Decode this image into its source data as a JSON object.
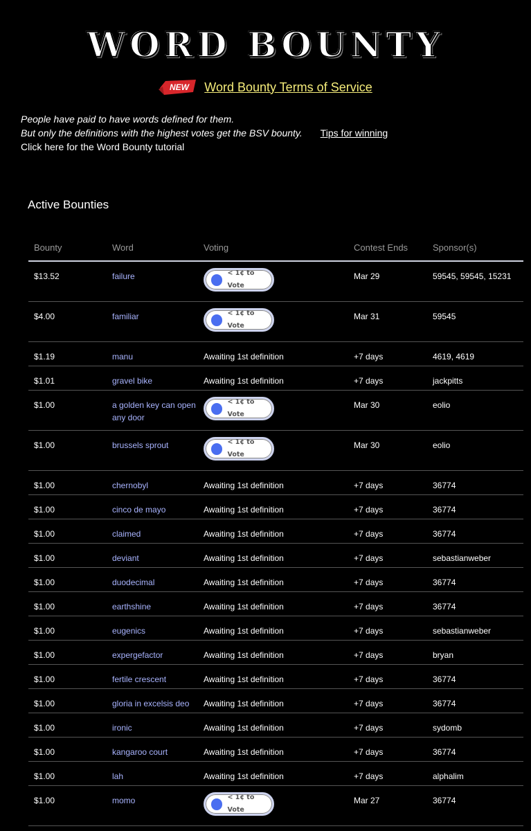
{
  "header": {
    "logo_text": "WORD BOUNTY",
    "new_badge": "NEW",
    "tos_link": "Word Bounty Terms of Service"
  },
  "intro": {
    "line1": "People have paid to have words defined for them.",
    "line2": "But only the definitions with the highest votes get the BSV bounty.",
    "tips_link": "Tips for winning",
    "tutorial_link": "Click here for the Word Bounty tutorial"
  },
  "section_title": "Active Bounties",
  "table": {
    "columns": [
      "Bounty",
      "Word",
      "Voting",
      "Contest Ends",
      "Sponsor(s)"
    ],
    "vote_label": "< 1¢ to Vote",
    "rows": [
      {
        "bounty": "$13.52",
        "word": "failure",
        "voting": "vote",
        "ends": "Mar 29",
        "sponsors": "59545, 59545, 15231"
      },
      {
        "bounty": "$4.00",
        "word": "familiar",
        "voting": "vote",
        "ends": "Mar 31",
        "sponsors": "59545"
      },
      {
        "bounty": "$1.19",
        "word": "manu",
        "voting": "Awaiting 1st definition",
        "ends": "+7 days",
        "sponsors": "4619, 4619"
      },
      {
        "bounty": "$1.01",
        "word": "gravel bike",
        "voting": "Awaiting 1st definition",
        "ends": "+7 days",
        "sponsors": "jackpitts"
      },
      {
        "bounty": "$1.00",
        "word": "a golden key can open any door",
        "voting": "vote",
        "ends": "Mar 30",
        "sponsors": "eolio"
      },
      {
        "bounty": "$1.00",
        "word": "brussels sprout",
        "voting": "vote",
        "ends": "Mar 30",
        "sponsors": "eolio"
      },
      {
        "bounty": "$1.00",
        "word": "chernobyl",
        "voting": "Awaiting 1st definition",
        "ends": "+7 days",
        "sponsors": "36774"
      },
      {
        "bounty": "$1.00",
        "word": "cinco de mayo",
        "voting": "Awaiting 1st definition",
        "ends": "+7 days",
        "sponsors": "36774"
      },
      {
        "bounty": "$1.00",
        "word": "claimed",
        "voting": "Awaiting 1st definition",
        "ends": "+7 days",
        "sponsors": "36774"
      },
      {
        "bounty": "$1.00",
        "word": "deviant",
        "voting": "Awaiting 1st definition",
        "ends": "+7 days",
        "sponsors": "sebastianweber"
      },
      {
        "bounty": "$1.00",
        "word": "duodecimal",
        "voting": "Awaiting 1st definition",
        "ends": "+7 days",
        "sponsors": "36774"
      },
      {
        "bounty": "$1.00",
        "word": "earthshine",
        "voting": "Awaiting 1st definition",
        "ends": "+7 days",
        "sponsors": "36774"
      },
      {
        "bounty": "$1.00",
        "word": "eugenics",
        "voting": "Awaiting 1st definition",
        "ends": "+7 days",
        "sponsors": "sebastianweber"
      },
      {
        "bounty": "$1.00",
        "word": "expergefactor",
        "voting": "Awaiting 1st definition",
        "ends": "+7 days",
        "sponsors": "bryan"
      },
      {
        "bounty": "$1.00",
        "word": "fertile crescent",
        "voting": "Awaiting 1st definition",
        "ends": "+7 days",
        "sponsors": "36774"
      },
      {
        "bounty": "$1.00",
        "word": "gloria in excelsis deo",
        "voting": "Awaiting 1st definition",
        "ends": "+7 days",
        "sponsors": "36774"
      },
      {
        "bounty": "$1.00",
        "word": "ironic",
        "voting": "Awaiting 1st definition",
        "ends": "+7 days",
        "sponsors": "sydomb"
      },
      {
        "bounty": "$1.00",
        "word": "kangaroo court",
        "voting": "Awaiting 1st definition",
        "ends": "+7 days",
        "sponsors": "36774"
      },
      {
        "bounty": "$1.00",
        "word": "lah",
        "voting": "Awaiting 1st definition",
        "ends": "+7 days",
        "sponsors": "alphalim"
      },
      {
        "bounty": "$1.00",
        "word": "momo",
        "voting": "vote",
        "ends": "Mar 27",
        "sponsors": "36774"
      }
    ]
  },
  "colors": {
    "background": "#000000",
    "link_yellow": "#f5ec7a",
    "word_link": "#a9b4ff",
    "vote_dot": "#4a6ef0",
    "badge_red": "#d8262b"
  }
}
